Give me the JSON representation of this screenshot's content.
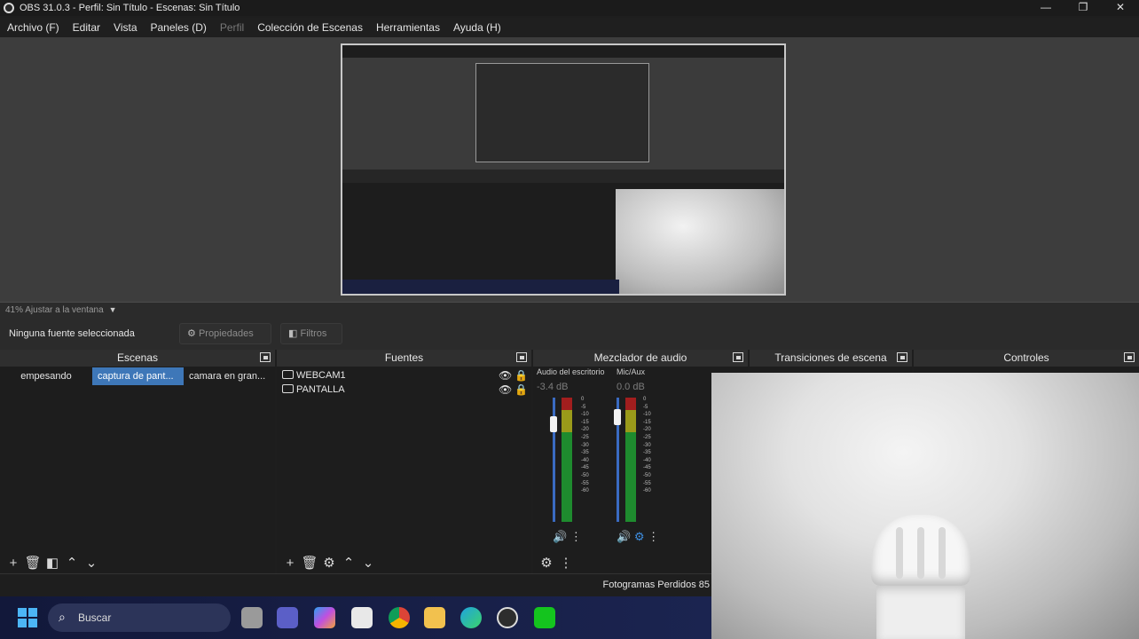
{
  "window": {
    "title": "OBS 31.0.3 - Perfil: Sin Título - Escenas: Sin Título",
    "controls": [
      "—",
      "❐",
      "✕"
    ]
  },
  "menu": [
    {
      "label": "Archivo (F)",
      "disabled": false
    },
    {
      "label": "Editar",
      "disabled": false
    },
    {
      "label": "Vista",
      "disabled": false
    },
    {
      "label": "Paneles (D)",
      "disabled": false
    },
    {
      "label": "Perfil",
      "disabled": true
    },
    {
      "label": "Colección de Escenas",
      "disabled": false
    },
    {
      "label": "Herramientas",
      "disabled": false
    },
    {
      "label": "Ayuda (H)",
      "disabled": false
    }
  ],
  "preview": {
    "zoom_label": "41% Ajustar a la ventana"
  },
  "source_toolbar": {
    "status": "Ninguna fuente seleccionada",
    "properties": "Propiedades",
    "filters": "Filtros"
  },
  "docks": {
    "scenes": {
      "title": "Escenas",
      "items": [
        "empesando",
        "captura de pant...",
        "camara en gran..."
      ],
      "active_index": 1
    },
    "sources": {
      "title": "Fuentes",
      "items": [
        {
          "name": "WEBCAM1",
          "icon": "camera-icon"
        },
        {
          "name": "PANTALLA",
          "icon": "monitor-icon"
        }
      ]
    },
    "mixer": {
      "title": "Mezclador de audio",
      "channels": [
        {
          "name": "Audio del escritorio",
          "db": "-3.4 dB",
          "level": 0.82
        },
        {
          "name": "Mic/Aux",
          "db": "0.0 dB",
          "level": 0.88
        }
      ],
      "scale": [
        "0",
        "-5",
        "-10",
        "-15",
        "-20",
        "-25",
        "-30",
        "-35",
        "-40",
        "-45",
        "-50",
        "-55",
        "-60"
      ]
    },
    "transitions": {
      "title": "Transiciones de escena"
    },
    "controls": {
      "title": "Controles"
    }
  },
  "status": {
    "frames_lost": "Fotogramas Perdidos 85"
  },
  "taskbar": {
    "search_placeholder": "Buscar"
  }
}
